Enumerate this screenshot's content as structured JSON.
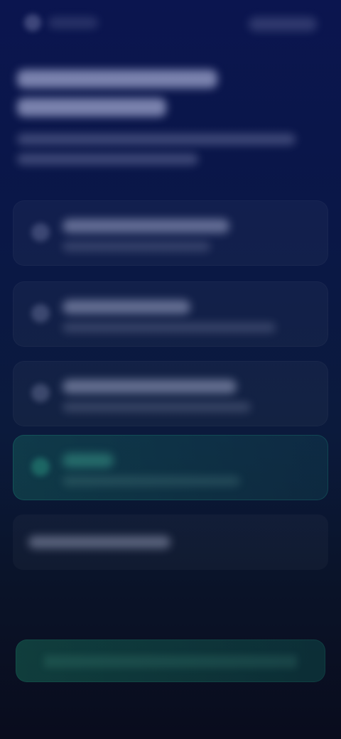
{
  "page": {
    "background_colors": {
      "top": "#0b154f",
      "mid": "#0b1a3c",
      "bottom": "#090c1d"
    }
  },
  "header": {
    "brand_text": "",
    "action_text": ""
  },
  "content": {
    "title_line_1": "",
    "title_line_2": "",
    "subtitle_line_1": "",
    "subtitle_line_2": ""
  },
  "options": [
    {
      "title": "",
      "subtitle": "",
      "icon": "circle-icon"
    },
    {
      "title": "",
      "subtitle": "",
      "icon": "circle-icon"
    },
    {
      "title": "",
      "subtitle": "",
      "icon": "circle-icon"
    },
    {
      "title": "",
      "subtitle": "",
      "icon": "circle-icon",
      "accent": "#2fd3a8"
    }
  ],
  "row": {
    "label": ""
  },
  "cta": {
    "label": ""
  }
}
